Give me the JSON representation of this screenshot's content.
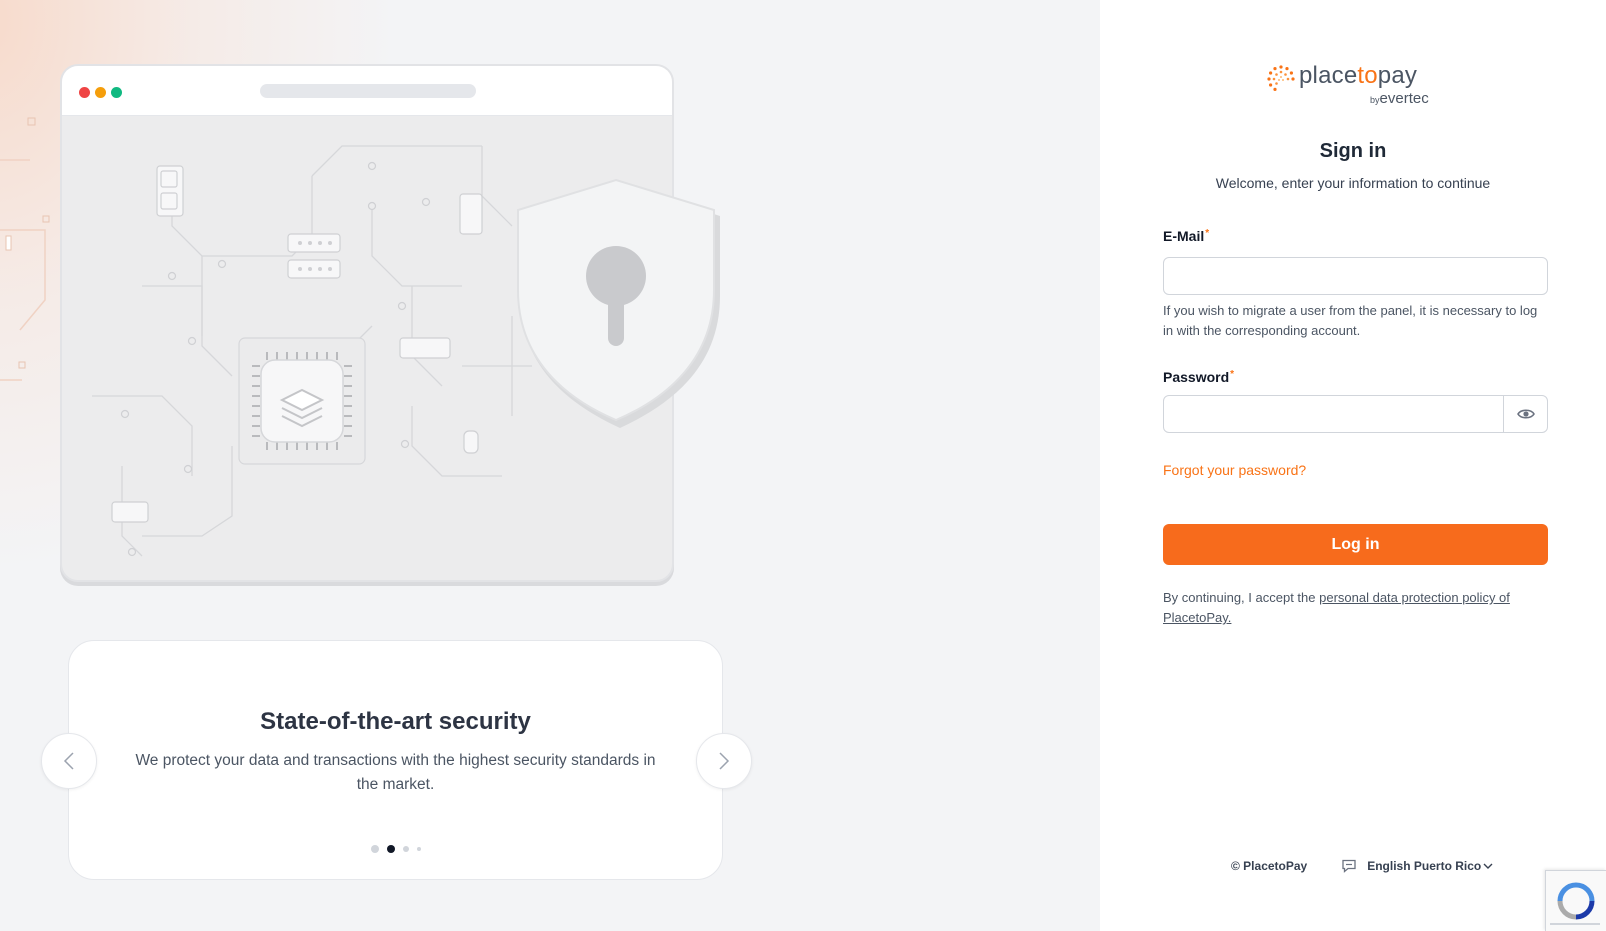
{
  "carousel": {
    "title": "State-of-the-art security",
    "text": "We protect your data and transactions with the highest security standards in the market.",
    "total_slides": 4,
    "active_slide": 2
  },
  "brand": {
    "word_a": "place",
    "word_to": "to",
    "word_b": "pay",
    "by": "by",
    "company": "evertec",
    "accent": "#f97316",
    "button_color": "#f76b1c"
  },
  "form": {
    "title": "Sign in",
    "subtitle": "Welcome, enter your information to continue",
    "email_label": "E-Mail",
    "email_value": "",
    "required_mark": "*",
    "email_help": "If you wish to migrate a user from the panel, it is necessary to log in with the corresponding account.",
    "password_label": "Password",
    "password_value": "",
    "show_password_icon": "eye-icon",
    "forgot_link": "Forgot your password?",
    "login_button": "Log in",
    "consent_prefix": "By continuing, I accept the ",
    "consent_link": "personal data protection policy of PlacetoPay."
  },
  "footer": {
    "copyright": "© PlacetoPay",
    "language": "English Puerto Rico",
    "language_icon": "chat-icon",
    "dropdown_icon": "chevron-down-icon"
  }
}
